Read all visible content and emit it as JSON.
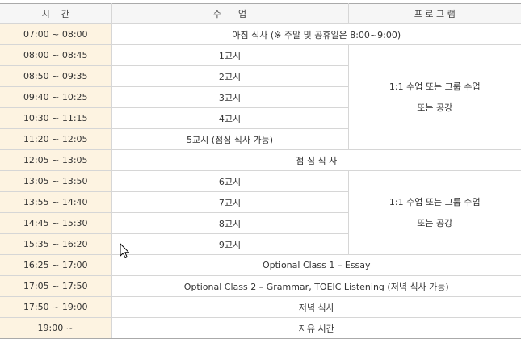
{
  "header": {
    "time": "시    간",
    "class": "수      업",
    "program": "프 로 그 램"
  },
  "rows": [
    {
      "time": "07:00 ~ 08:00",
      "class": "아침 식사 (※ 주말 및 공휴일은 8:00~9:00)"
    },
    {
      "time": "08:00 ~ 08:45",
      "class": "1교시"
    },
    {
      "time": "08:50 ~ 09:35",
      "class": "2교시"
    },
    {
      "time": "09:40 ~ 10:25",
      "class": "3교시"
    },
    {
      "time": "10:30 ~ 11:15",
      "class": "4교시"
    },
    {
      "time": "11:20 ~ 12:05",
      "class": "5교시 (점심 식사 가능)"
    },
    {
      "time": "12:05 ~ 13:05",
      "class": "점 심 식 사"
    },
    {
      "time": "13:05 ~ 13:50",
      "class": "6교시"
    },
    {
      "time": "13:55 ~ 14:40",
      "class": "7교시"
    },
    {
      "time": "14:45 ~ 15:30",
      "class": "8교시"
    },
    {
      "time": "15:35 ~ 16:20",
      "class": "9교시"
    },
    {
      "time": "16:25 ~ 17:00",
      "class": "Optional Class 1 – Essay"
    },
    {
      "time": "17:05 ~ 17:50",
      "class": "Optional Class 2 – Grammar, TOEIC Listening (저녁 식사 가능)"
    },
    {
      "time": "17:50 ~ 19:00",
      "class": "저녁 식사"
    },
    {
      "time": "19:00 ~",
      "class": "자유 시간"
    }
  ],
  "program_blocks": [
    {
      "line1": "1:1 수업 또는 그룹 수업",
      "line2": "또는 공강"
    },
    {
      "line1": "1:1 수업 또는 그룹 수업",
      "line2": "또는 공강"
    }
  ],
  "icons": {
    "cursor": "mouse-pointer-icon"
  }
}
